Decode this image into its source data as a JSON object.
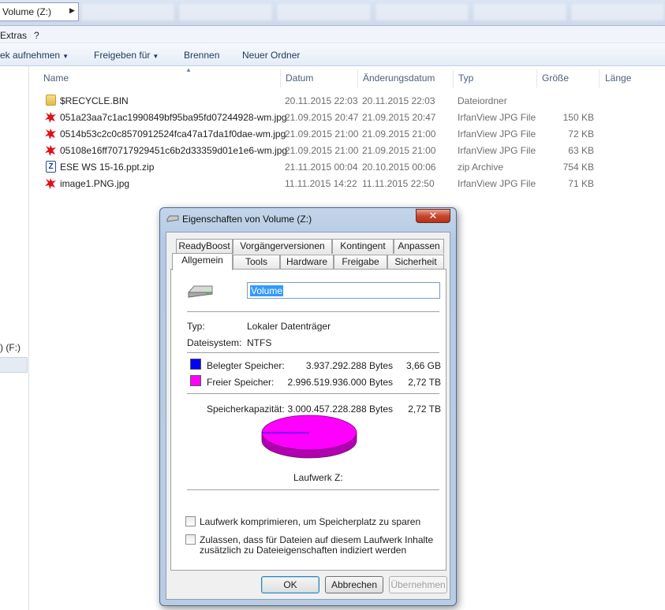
{
  "addressbar": {
    "path": "Volume (Z:)"
  },
  "menubar": {
    "items": [
      "Extras",
      "?"
    ]
  },
  "toolbar": {
    "items": [
      {
        "label": "ek aufnehmen",
        "caret": "▼"
      },
      {
        "label": "Freigeben für",
        "caret": "▼"
      },
      {
        "label": "Brennen",
        "caret": ""
      },
      {
        "label": "Neuer Ordner",
        "caret": ""
      }
    ]
  },
  "navpane": {
    "drive_label": ") (F:)"
  },
  "columns": [
    "Name",
    "Datum",
    "Änderungsdatum",
    "Typ",
    "Größe",
    "Länge"
  ],
  "files": [
    {
      "icon": "folder-icon",
      "name": "$RECYCLE.BIN",
      "date": "20.11.2015 22:03",
      "modified": "20.11.2015 22:03",
      "type": "Dateiordner",
      "size": ""
    },
    {
      "icon": "irfanview-icon",
      "name": "051a23aa7c1ac1990849bf95ba95fd07244928-wm.jpg",
      "date": "21.09.2015 20:47",
      "modified": "21.09.2015 20:47",
      "type": "IrfanView JPG File",
      "size": "150 KB"
    },
    {
      "icon": "irfanview-icon",
      "name": "0514b53c2c0c8570912524fca47a17da1f0dae-wm.jpg",
      "date": "21.09.2015 21:00",
      "modified": "21.09.2015 21:00",
      "type": "IrfanView JPG File",
      "size": "72 KB"
    },
    {
      "icon": "irfanview-icon",
      "name": "05108e16ff70717929451c6b2d33359d01e1e6-wm.jpg",
      "date": "21.09.2015 21:00",
      "modified": "21.09.2015 21:00",
      "type": "IrfanView JPG File",
      "size": "63 KB"
    },
    {
      "icon": "zip-icon",
      "name": "ESE WS 15-16.ppt.zip",
      "date": "21.11.2015 00:04",
      "modified": "20.10.2015 00:06",
      "type": "zip Archive",
      "size": "754 KB"
    },
    {
      "icon": "irfanview-icon",
      "name": "image1.PNG.jpg",
      "date": "11.11.2015 14:22",
      "modified": "11.11.2015 22:50",
      "type": "IrfanView JPG File",
      "size": "71 KB"
    }
  ],
  "dialog": {
    "title": "Eigenschaften von Volume (Z:)",
    "close_glyph": "✕",
    "tabs_row1": [
      "ReadyBoost",
      "Vorgängerversionen",
      "Kontingent",
      "Anpassen"
    ],
    "tabs_row2": [
      "Allgemein",
      "Tools",
      "Hardware",
      "Freigabe",
      "Sicherheit"
    ],
    "active_tab": "Allgemein",
    "volume_name": "Volume",
    "type_label": "Typ:",
    "type_value": "Lokaler Datenträger",
    "fs_label": "Dateisystem:",
    "fs_value": "NTFS",
    "used_label": "Belegter Speicher:",
    "used_bytes": "3.937.292.288 Bytes",
    "used_human": "3,66 GB",
    "used_color": "#0000ff",
    "free_label": "Freier Speicher:",
    "free_bytes": "2.996.519.936.000 Bytes",
    "free_human": "2,72 TB",
    "free_color": "#ff00ff",
    "cap_label": "Speicherkapazität:",
    "cap_bytes": "3.000.457.228.288 Bytes",
    "cap_human": "2,72 TB",
    "used_fraction": 0.0013,
    "drive_caption": "Laufwerk Z:",
    "compress_label": "Laufwerk komprimieren, um Speicherplatz zu sparen",
    "compress_checked": false,
    "index_label_1": "Zulassen, dass für Dateien auf diesem Laufwerk Inhalte",
    "index_label_2": "zusätzlich zu Dateieigenschaften indiziert werden",
    "index_checked": false,
    "ok_label": "OK",
    "cancel_label": "Abbrechen",
    "apply_label": "Übernehmen"
  }
}
